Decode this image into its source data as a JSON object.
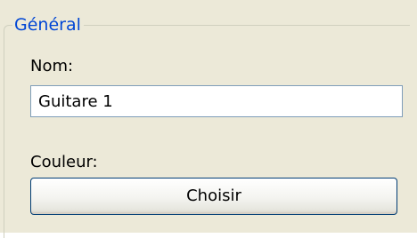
{
  "group": {
    "title": "Général"
  },
  "name_field": {
    "label": "Nom:",
    "value": "Guitare 1"
  },
  "color_field": {
    "label": "Couleur:",
    "button_label": "Choisir"
  },
  "colors": {
    "background": "#ece9d8",
    "group_title": "#0046d5",
    "group_border": "#d0d0bf",
    "input_border": "#7f9db9",
    "button_border": "#003c74"
  }
}
